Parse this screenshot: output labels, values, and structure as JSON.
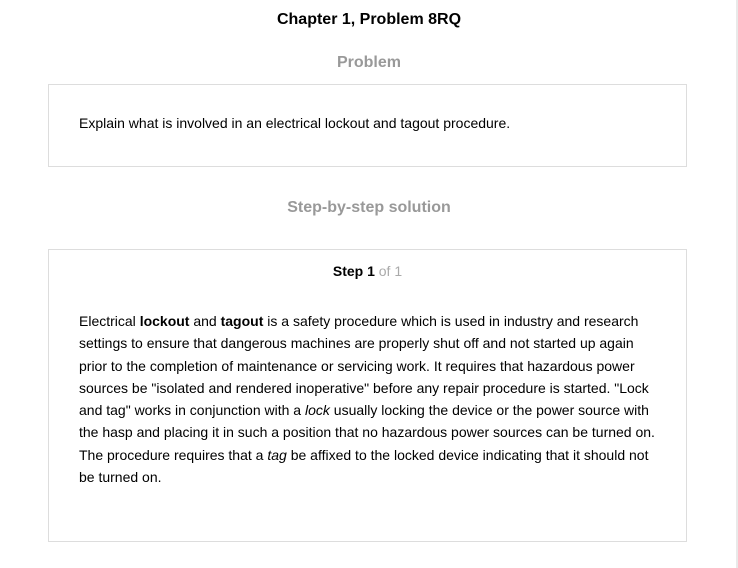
{
  "page": {
    "title": "Chapter 1, Problem 8RQ"
  },
  "problem": {
    "heading": "Problem",
    "text": "Explain what is involved in an electrical lockout and tagout procedure."
  },
  "solution": {
    "heading": "Step-by-step solution",
    "step": {
      "label": "Step 1",
      "of_text": " of 1",
      "body": [
        {
          "text": "Electrical ",
          "style": "normal"
        },
        {
          "text": "lockout",
          "style": "bold"
        },
        {
          "text": " and ",
          "style": "normal"
        },
        {
          "text": "tagout",
          "style": "bold"
        },
        {
          "text": " is a safety procedure which is used in industry and research settings to ensure that dangerous machines are properly shut off and not started up again prior to the completion of maintenance or servicing work. It requires that hazardous power sources be \"isolated and rendered inoperative\" before any repair procedure is started. \"Lock and tag\" works in conjunction with a ",
          "style": "normal"
        },
        {
          "text": "lock",
          "style": "italic"
        },
        {
          "text": " usually locking the device or the power source with the hasp and placing it in such a position that no hazardous power sources can be turned on. The procedure requires that a ",
          "style": "normal"
        },
        {
          "text": "tag",
          "style": "italic"
        },
        {
          "text": " be affixed to the locked device indicating that it should not be turned on.",
          "style": "normal"
        }
      ]
    }
  }
}
